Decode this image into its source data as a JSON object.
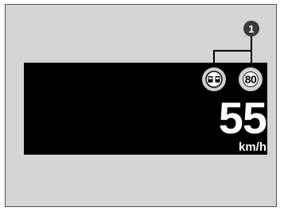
{
  "callout": {
    "number": "1"
  },
  "signs": {
    "no_overtaking_icon": "no-overtaking-sign",
    "speed_limit": "80"
  },
  "display": {
    "speed": "55",
    "unit": "km/h"
  },
  "colors": {
    "frame_background": "#d4d4d4",
    "screen_background": "#000000",
    "callout_fill": "#3a3a3a"
  }
}
